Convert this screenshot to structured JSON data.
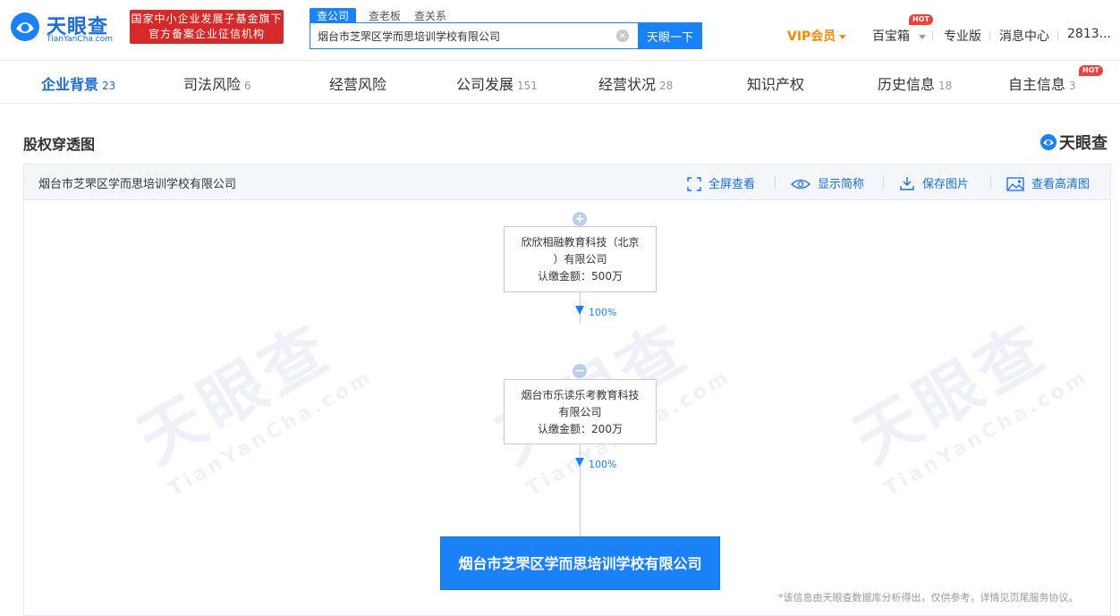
{
  "header": {
    "logo_text": "天眼查",
    "logo_sub": "TianYanCha.com",
    "gov_badge": [
      "国家中小企业发展子基金旗下",
      "官方备案企业征信机构"
    ],
    "search_tabs": [
      "查公司",
      "查老板",
      "查关系"
    ],
    "search_value": "烟台市芝罘区学而思培训学校有限公司",
    "search_button": "天眼一下",
    "nav": {
      "vip": "VIP会员",
      "baibaoxiang": "百宝箱",
      "hot": "HOT",
      "pro": "专业版",
      "messages": "消息中心",
      "user": "2813..."
    }
  },
  "tabs": [
    {
      "label": "企业背景",
      "count": "23"
    },
    {
      "label": "司法风险",
      "count": "6"
    },
    {
      "label": "经营风险",
      "count": ""
    },
    {
      "label": "公司发展",
      "count": "151"
    },
    {
      "label": "经营状况",
      "count": "28"
    },
    {
      "label": "知识产权",
      "count": ""
    },
    {
      "label": "历史信息",
      "count": "18"
    },
    {
      "label": "自主信息",
      "count": "3"
    }
  ],
  "tabs_hot": "HOT",
  "section": {
    "title": "股权穿透图",
    "brand": "天眼查"
  },
  "panel": {
    "title": "烟台市芝罘区学而思培训学校有限公司",
    "tools": [
      "全屏查看",
      "显示简称",
      "保存图片",
      "查看高清图"
    ],
    "watermark_text": "天眼查",
    "watermark_sub": "TianYanCha.com",
    "nodes": [
      {
        "name_line1": "欣欣相融教育科技（北京",
        "name_line2": "）有限公司",
        "amount": "认缴金额：500万",
        "toggle": "+",
        "pct": "100%"
      },
      {
        "name_line1": "烟台市乐读乐考教育科技",
        "name_line2": "有限公司",
        "amount": "认缴金额：200万",
        "toggle": "−",
        "pct": "100%"
      }
    ],
    "target": "烟台市芝罘区学而思培训学校有限公司",
    "disclaimer": "*该信息由天眼查数据库分析得出，仅供参考，详情见页尾服务协议。"
  },
  "colors": {
    "brand_blue": "#1a82f6",
    "badge_red": "#d62a2a",
    "vip_orange": "#f08b0c"
  }
}
